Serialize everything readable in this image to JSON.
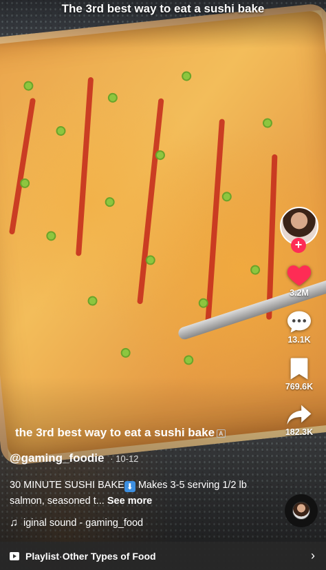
{
  "overlay_caption": "The 3rd best way to eat a sushi bake",
  "actions": {
    "likes": "3.2M",
    "comments": "13.1K",
    "saves": "769.6K",
    "shares": "182.3K"
  },
  "video": {
    "title": "the 3rd best way to eat a sushi bake",
    "author": "@gaming_foodie",
    "date": "· 10-12",
    "description_a": "30 MINUTE SUSHI BAKE",
    "description_b": " Makes 3-5 serving 1/2 lb salmon, seasoned t...",
    "see_more": "See more",
    "sound": "iginal sound - gaming_food"
  },
  "playlist": {
    "label": "Playlist",
    "separator": " · ",
    "name": "Other Types of Food"
  },
  "colors": {
    "like": "#fe2c55",
    "follow": "#fe2c55"
  }
}
